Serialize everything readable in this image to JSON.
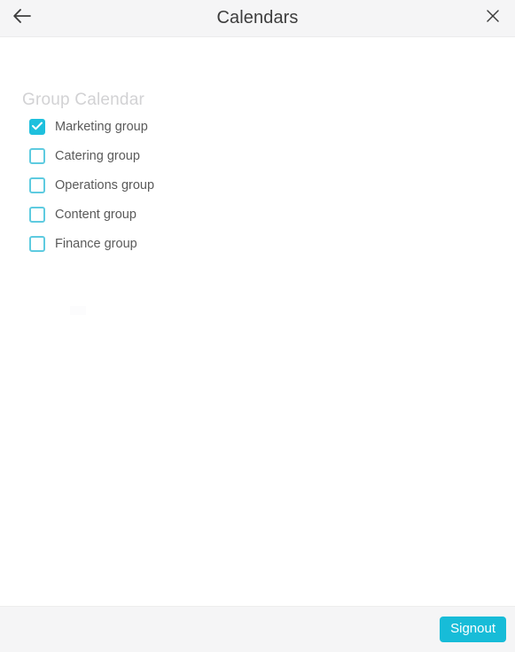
{
  "header": {
    "title": "Calendars",
    "back_icon": "arrow-left-icon",
    "close_icon": "close-icon"
  },
  "main": {
    "section_title": "Group Calendar",
    "calendars": [
      {
        "label": "Marketing group",
        "checked": true
      },
      {
        "label": "Catering group",
        "checked": false
      },
      {
        "label": "Operations group",
        "checked": false
      },
      {
        "label": "Content group",
        "checked": false
      },
      {
        "label": "Finance group",
        "checked": false
      }
    ]
  },
  "footer": {
    "signout_label": "Signout"
  },
  "colors": {
    "accent": "#1ec0dd",
    "button": "#17bcd8",
    "checkbox_border": "#5ecbe0",
    "header_bg": "#f5f5f6",
    "section_title": "#d2d2d4",
    "label_text": "#5a5a5a",
    "title_text": "#3d3d3d"
  }
}
